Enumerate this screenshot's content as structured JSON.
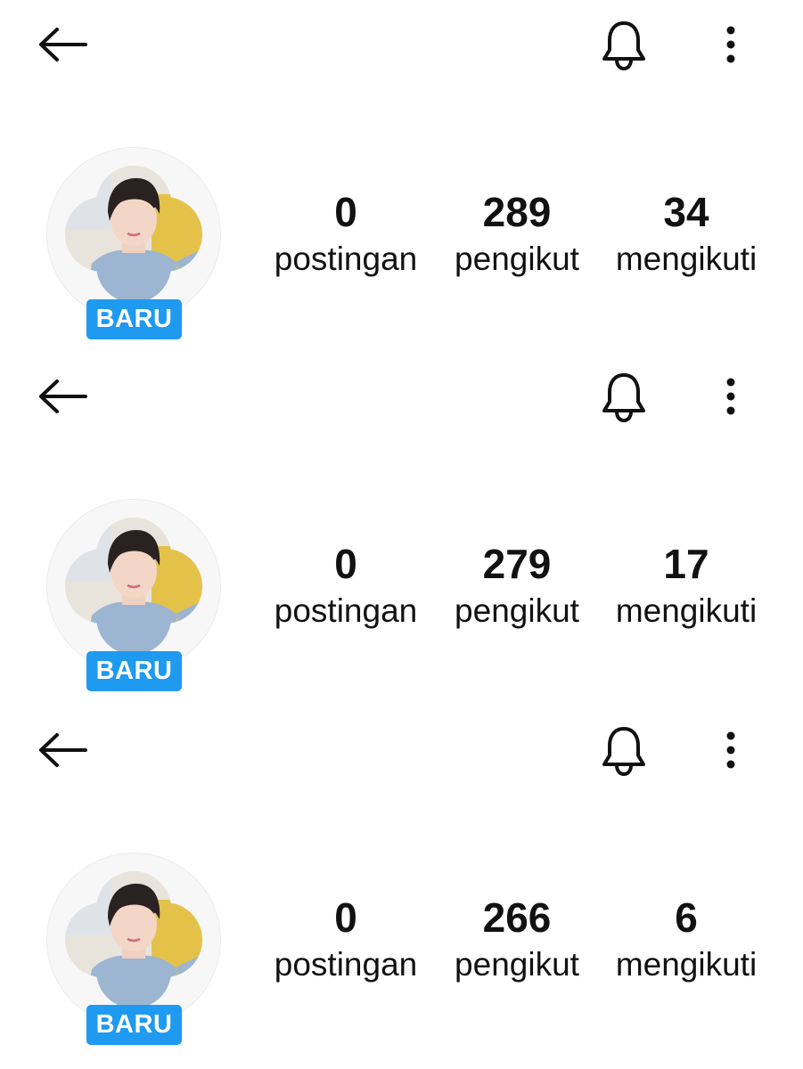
{
  "profiles": [
    {
      "badge": "BARU",
      "stats": [
        {
          "value": "0",
          "label": "postingan"
        },
        {
          "value": "289",
          "label": "pengikut"
        },
        {
          "value": "34",
          "label": "mengikuti"
        }
      ]
    },
    {
      "badge": "BARU",
      "stats": [
        {
          "value": "0",
          "label": "postingan"
        },
        {
          "value": "279",
          "label": "pengikut"
        },
        {
          "value": "17",
          "label": "mengikuti"
        }
      ]
    },
    {
      "badge": "BARU",
      "stats": [
        {
          "value": "0",
          "label": "postingan"
        },
        {
          "value": "266",
          "label": "pengikut"
        },
        {
          "value": "6",
          "label": "mengikuti"
        }
      ]
    }
  ],
  "icons": {
    "back": "back-arrow-icon",
    "notifications": "bell-icon",
    "more": "more-vertical-icon",
    "avatar": "profile-photo"
  },
  "colors": {
    "badge_background": "#1e9af0",
    "badge_text": "#ffffff",
    "text": "#111111",
    "background": "#ffffff"
  }
}
